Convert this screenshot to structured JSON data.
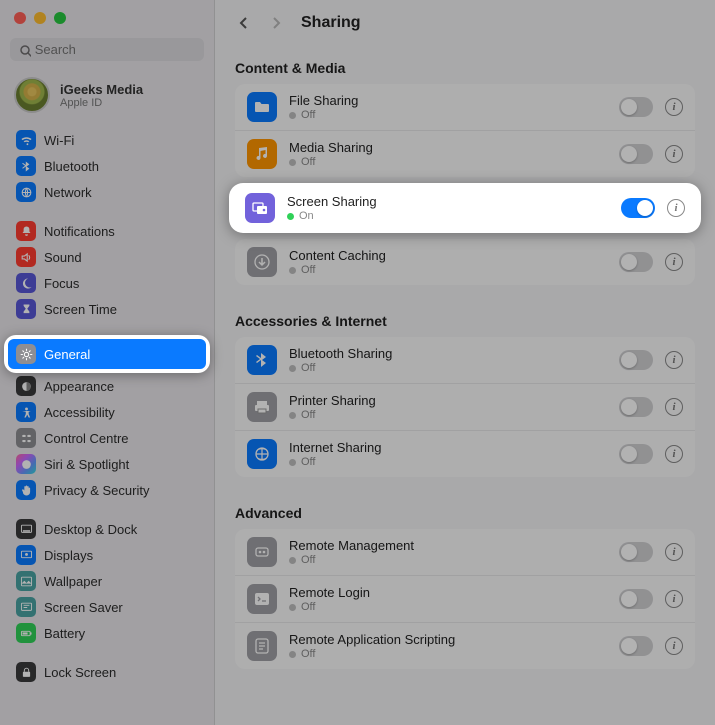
{
  "window": {
    "title": "Sharing"
  },
  "search": {
    "placeholder": "Search"
  },
  "account": {
    "name": "iGeeks Media",
    "sub": "Apple ID"
  },
  "sidebar": {
    "g1": [
      {
        "label": "Wi-Fi",
        "icon": "wifi-icon",
        "color": "c-blue"
      },
      {
        "label": "Bluetooth",
        "icon": "bluetooth-icon",
        "color": "c-blue"
      },
      {
        "label": "Network",
        "icon": "network-icon",
        "color": "c-blue"
      }
    ],
    "g2": [
      {
        "label": "Notifications",
        "icon": "bell-icon",
        "color": "c-red"
      },
      {
        "label": "Sound",
        "icon": "sound-icon",
        "color": "c-red"
      },
      {
        "label": "Focus",
        "icon": "moon-icon",
        "color": "c-darkpurple"
      },
      {
        "label": "Screen Time",
        "icon": "hourglass-icon",
        "color": "c-darkpurple"
      }
    ],
    "g3": [
      {
        "label": "General",
        "icon": "gear-icon",
        "color": "c-ggray",
        "selected": true
      },
      {
        "label": "Appearance",
        "icon": "appearance-icon",
        "color": "c-black"
      },
      {
        "label": "Accessibility",
        "icon": "accessibility-icon",
        "color": "c-blue"
      },
      {
        "label": "Control Centre",
        "icon": "controls-icon",
        "color": "c-ggray"
      },
      {
        "label": "Siri & Spotlight",
        "icon": "siri-icon",
        "color": "c-grad"
      },
      {
        "label": "Privacy & Security",
        "icon": "hand-icon",
        "color": "c-blue"
      }
    ],
    "g4": [
      {
        "label": "Desktop & Dock",
        "icon": "dock-icon",
        "color": "c-black"
      },
      {
        "label": "Displays",
        "icon": "display-icon",
        "color": "c-blue"
      },
      {
        "label": "Wallpaper",
        "icon": "wallpaper-icon",
        "color": "c-teal"
      },
      {
        "label": "Screen Saver",
        "icon": "screensaver-icon",
        "color": "c-teal"
      },
      {
        "label": "Battery",
        "icon": "battery-icon",
        "color": "c-green"
      }
    ],
    "g5": [
      {
        "label": "Lock Screen",
        "icon": "lock-icon",
        "color": "c-black"
      }
    ]
  },
  "status": {
    "on": "On",
    "off": "Off"
  },
  "sections": {
    "content_media": {
      "title": "Content & Media",
      "items": [
        {
          "label": "File Sharing",
          "status": "off",
          "icon": "folder-icon",
          "color": "c-blue"
        },
        {
          "label": "Media Sharing",
          "status": "off",
          "icon": "music-icon",
          "color": "c-orange"
        },
        {
          "label": "Screen Sharing",
          "status": "on",
          "icon": "screens-icon",
          "color": "c-purple",
          "highlight": true
        },
        {
          "label": "Content Caching",
          "status": "off",
          "icon": "download-icon",
          "color": "c-gray"
        }
      ]
    },
    "accessories": {
      "title": "Accessories & Internet",
      "items": [
        {
          "label": "Bluetooth Sharing",
          "status": "off",
          "icon": "bluetooth-icon",
          "color": "c-blue"
        },
        {
          "label": "Printer Sharing",
          "status": "off",
          "icon": "printer-icon",
          "color": "c-gray"
        },
        {
          "label": "Internet Sharing",
          "status": "off",
          "icon": "globe-icon",
          "color": "c-blue"
        }
      ]
    },
    "advanced": {
      "title": "Advanced",
      "items": [
        {
          "label": "Remote Management",
          "status": "off",
          "icon": "remote-icon",
          "color": "c-gray"
        },
        {
          "label": "Remote Login",
          "status": "off",
          "icon": "terminal-icon",
          "color": "c-gray"
        },
        {
          "label": "Remote Application Scripting",
          "status": "off",
          "icon": "script-icon",
          "color": "c-gray"
        }
      ]
    }
  }
}
